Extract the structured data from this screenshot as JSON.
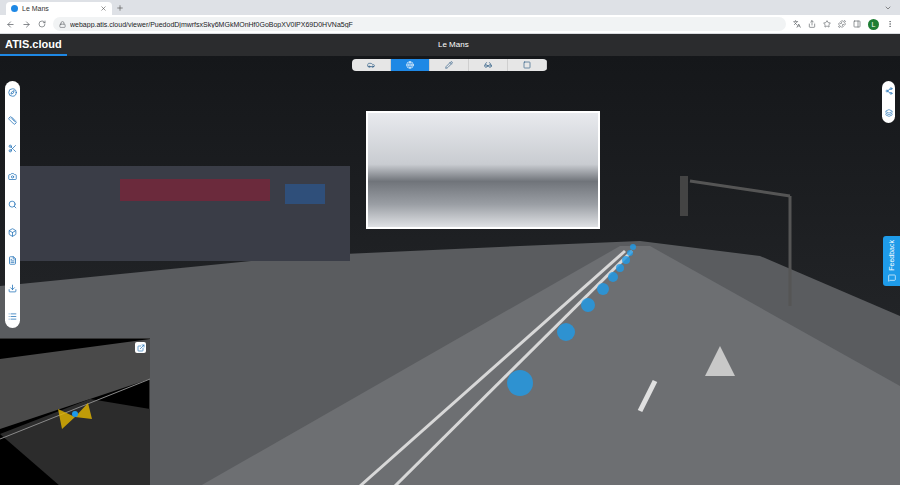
{
  "browser": {
    "tab": {
      "title": "Le Mans"
    },
    "url": "webapp.atis.cloud/viewer/PuedodDjmwrfsxSky6MGkMOnHf0GoBopXV0lPX69D0HVNa5gF",
    "avatar": "L"
  },
  "app": {
    "brand": "ATIS.cloud",
    "project": "Le Mans"
  },
  "view_modes": [
    {
      "selected": false
    },
    {
      "selected": true
    },
    {
      "selected": false
    },
    {
      "selected": false
    },
    {
      "selected": false
    }
  ],
  "feedback": {
    "label": "Feedback"
  }
}
